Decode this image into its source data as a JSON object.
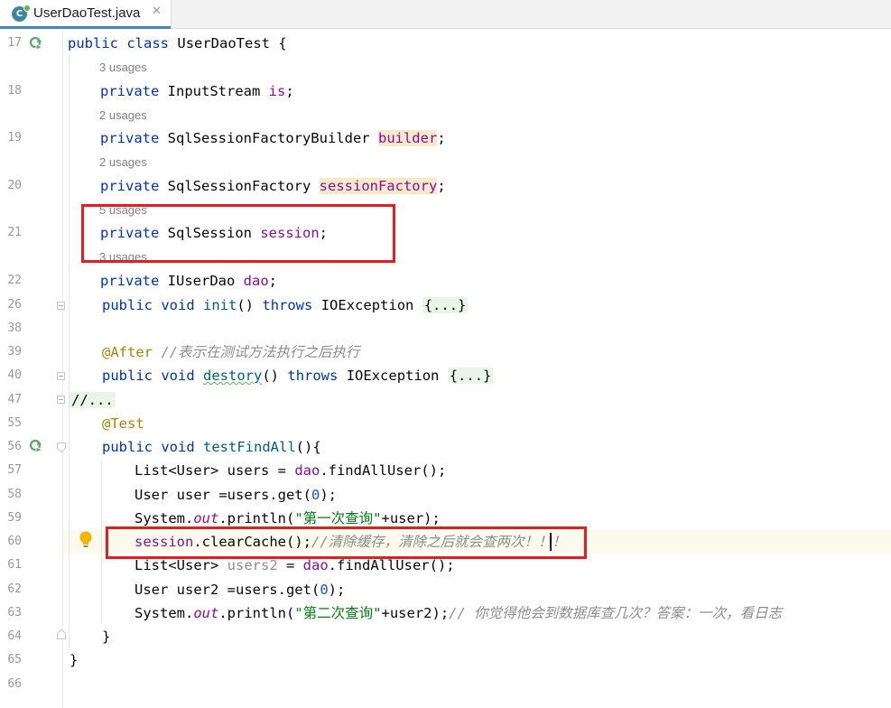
{
  "tab": {
    "title": "UserDaoTest.java",
    "icon_letter": "C",
    "close_glyph": "✕"
  },
  "gutter": {
    "line_numbers": [
      "17",
      "18",
      "19",
      "20",
      "21",
      "22",
      "26",
      "38",
      "39",
      "40",
      "47",
      "55",
      "56",
      "57",
      "58",
      "59",
      "60",
      "61",
      "62",
      "63",
      "64",
      "65",
      "66"
    ]
  },
  "usages": {
    "u3a": "3 usages",
    "u2a": "2 usages",
    "u2b": "2 usages",
    "u5": "5 usages",
    "u3b": "3 usages"
  },
  "code": {
    "l17": {
      "kw1": "public",
      "kw2": "class",
      "name": "UserDaoTest",
      "brace": "{"
    },
    "l18": {
      "kw": "private",
      "type": "InputStream",
      "field": "is",
      "end": ";"
    },
    "l19": {
      "kw": "private",
      "type": "SqlSessionFactoryBuilder",
      "field": "builder",
      "end": ";"
    },
    "l20": {
      "kw": "private",
      "type": "SqlSessionFactory",
      "field": "sessionFactory",
      "end": ";"
    },
    "l21": {
      "kw": "private",
      "type": "SqlSession",
      "field": "session",
      "end": ";"
    },
    "l22": {
      "kw": "private",
      "type": "IUserDao",
      "field": "dao",
      "end": ";"
    },
    "l26": {
      "kw1": "public",
      "kw2": "void",
      "method": "init",
      "parens": "()",
      "kw3": "throws",
      "exc": "IOException",
      "folded": "{...}"
    },
    "l39": {
      "annotation": "@After",
      "comment": "//表示在测试方法执行之后执行"
    },
    "l40": {
      "kw1": "public",
      "kw2": "void",
      "method": "destory",
      "parens": "()",
      "kw3": "throws",
      "exc": "IOException",
      "folded": "{...}"
    },
    "l47": {
      "folded": "//..."
    },
    "l55": {
      "annotation": "@Test"
    },
    "l56": {
      "kw1": "public",
      "kw2": "void",
      "method": "testFindAll",
      "rest": "(){"
    },
    "l57": {
      "a": "List<User> users = ",
      "field": "dao",
      "b": ".findAllUser();"
    },
    "l58": {
      "a": "User user =users.get(",
      "num": "0",
      "b": ");"
    },
    "l59": {
      "a": "System.",
      "static": "out",
      "b": ".println(",
      "str": "\"第一次查询\"",
      "c": "+user);"
    },
    "l60": {
      "field": "session",
      "a": ".clearCache();",
      "comment": "//清除缓存，清除之后就会查两次！！！"
    },
    "l61": {
      "a": "List<User> ",
      "unused": "users2",
      "b": " = ",
      "field": "dao",
      "c": ".findAllUser();"
    },
    "l62": {
      "a": "User user2 =users.get(",
      "num": "0",
      "b": ");"
    },
    "l63": {
      "a": "System.",
      "static": "out",
      "b": ".println(",
      "str": "\"第二次查询\"",
      "c": "+user2);",
      "comment": "// 你觉得他会到数据库查几次？答案：一次，看日志"
    },
    "l64": {
      "brace": "}"
    },
    "l65": {
      "brace": "}"
    }
  },
  "colors": {
    "keyword": "#0033b3",
    "field": "#871094",
    "method": "#00627a",
    "string": "#067d17",
    "number": "#1750eb",
    "annotation": "#9e880d",
    "comment": "#8c8c8c",
    "highlight_box": "#e02020"
  }
}
